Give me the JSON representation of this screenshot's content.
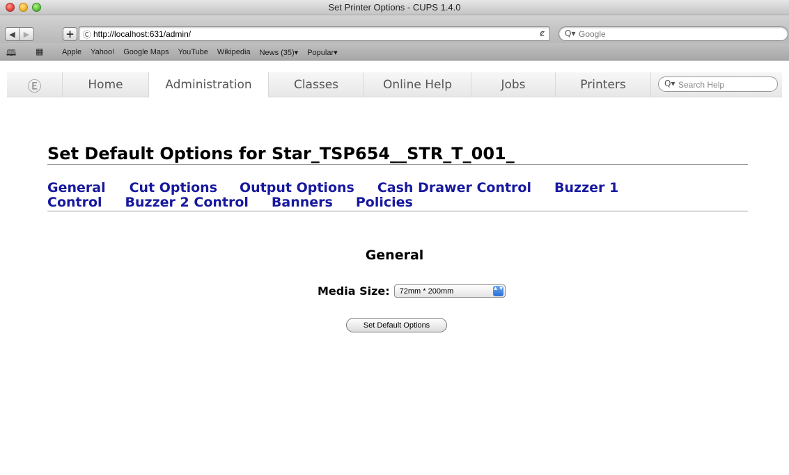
{
  "window": {
    "title": "Set Printer Options - CUPS 1.4.0"
  },
  "toolbar": {
    "back_icon": "◀",
    "forward_icon": "▶",
    "add_icon": "+",
    "favicon": "Ⓒ",
    "url": "http://localhost:631/admin/",
    "reload_icon": "ȼ",
    "search_icon": "Q▾",
    "search_placeholder": "Google"
  },
  "bookmarks": {
    "book_icon": "🕮",
    "grid_icon": "▦",
    "items": [
      "Apple",
      "Yahoo!",
      "Google Maps",
      "YouTube",
      "Wikipedia",
      "News (35)▾",
      "Popular▾"
    ]
  },
  "cups_nav": {
    "logo": "Ⓔ",
    "tabs": [
      "Home",
      "Administration",
      "Classes",
      "Online Help",
      "Jobs",
      "Printers"
    ],
    "active_tab": "Administration",
    "search_icon": "Q▾",
    "search_placeholder": "Search Help"
  },
  "page": {
    "title": "Set Default Options for Star_TSP654__STR_T_001_",
    "option_links": {
      "general": "General",
      "cut_options": "Cut Options",
      "output_options": "Output Options",
      "cash_drawer": "Cash Drawer Control",
      "buzzer1_a": "Buzzer 1",
      "buzzer1_b": "Control",
      "buzzer2": "Buzzer 2 Control",
      "banners": "Banners",
      "policies": "Policies"
    },
    "section_title": "General",
    "media_size_label": "Media Size:",
    "media_size_value": "72mm * 200mm",
    "select_arrows": "▲▼",
    "submit_label": "Set Default Options"
  }
}
